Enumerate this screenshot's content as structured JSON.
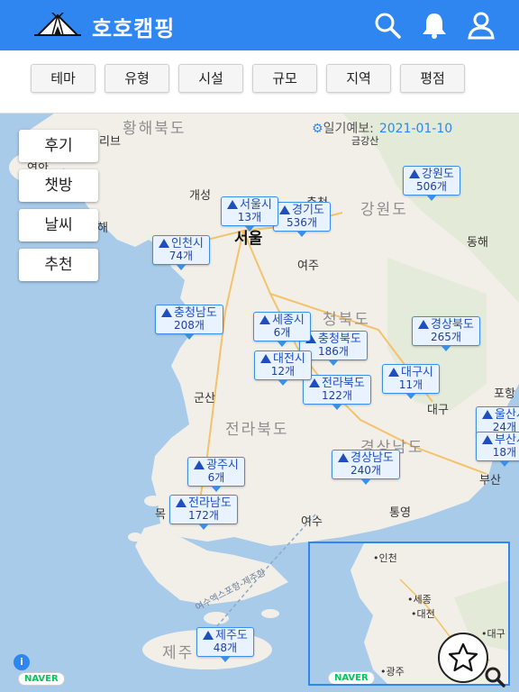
{
  "header": {
    "title": "호호캠핑",
    "icons": [
      "tent-logo-icon",
      "search-icon",
      "bell-icon",
      "user-icon"
    ]
  },
  "filters": [
    "테마",
    "유형",
    "시설",
    "규모",
    "지역",
    "평점"
  ],
  "side_buttons": [
    "후기",
    "챗방",
    "날씨",
    "추천"
  ],
  "weather": {
    "label": "일기예보:",
    "date": "2021-01-10"
  },
  "map_labels": {
    "hwanghae": "황해북도",
    "gangwon": "강원도",
    "chungbuk": "청북도",
    "jeonbuk": "전라북도",
    "gyeongnam": "경상남도",
    "jeju_region": "제주",
    "seoul": "서울",
    "gaeseong": "개성",
    "chuncheon": "춘천",
    "yeoju": "여주",
    "donghae": "동해",
    "gunsan": "군산",
    "daegu": "대구",
    "pohang": "포항",
    "busan": "부산",
    "yeosu": "여수",
    "tongyeong": "통영",
    "mokpo": "목",
    "geumgangsan": "금강산",
    "yeonan": "연안",
    "hae": "해",
    "rib": "리브",
    "ferry": "여수엑스포항-제주항"
  },
  "markers": [
    {
      "name": "강원도",
      "count": "506개"
    },
    {
      "name": "서울시",
      "count": "13개"
    },
    {
      "name": "경기도",
      "count": "536개"
    },
    {
      "name": "인천시",
      "count": "74개"
    },
    {
      "name": "충청남도",
      "count": "208개"
    },
    {
      "name": "세종시",
      "count": "6개"
    },
    {
      "name": "충청북도",
      "count": "186개"
    },
    {
      "name": "경상북도",
      "count": "265개"
    },
    {
      "name": "대전시",
      "count": "12개"
    },
    {
      "name": "전라북도",
      "count": "122개"
    },
    {
      "name": "대구시",
      "count": "11개"
    },
    {
      "name": "울산시",
      "count": "24개"
    },
    {
      "name": "부산시",
      "count": "18개"
    },
    {
      "name": "광주시",
      "count": "6개"
    },
    {
      "name": "경상남도",
      "count": "240개"
    },
    {
      "name": "전라남도",
      "count": "172개"
    },
    {
      "name": "제주도",
      "count": "48개"
    }
  ],
  "minimap": {
    "labels": [
      "인천",
      "세종",
      "대전",
      "대구",
      "광주"
    ]
  },
  "attribution": "NAVER",
  "info_label": "i",
  "colors": {
    "header": "#2f86f0",
    "sea": "#a9cbea",
    "land": "#f2efe9",
    "marker_border": "#3b8fe6"
  }
}
